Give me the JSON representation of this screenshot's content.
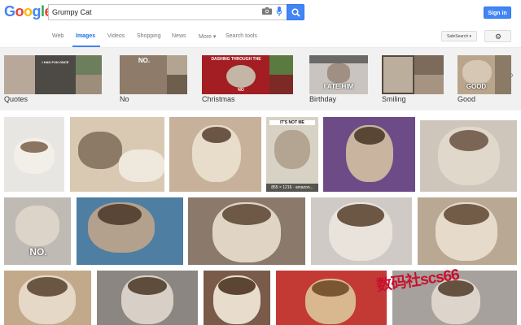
{
  "header": {
    "logo_letters": [
      {
        "ch": "G",
        "color": "#4285f4"
      },
      {
        "ch": "o",
        "color": "#ea4335"
      },
      {
        "ch": "o",
        "color": "#fbbc05"
      },
      {
        "ch": "g",
        "color": "#4285f4"
      },
      {
        "ch": "l",
        "color": "#34a853"
      },
      {
        "ch": "e",
        "color": "#ea4335"
      }
    ],
    "search_value": "Grumpy Cat",
    "signin_label": "Sign in"
  },
  "nav": {
    "tabs": [
      "Web",
      "Images",
      "Videos",
      "Shopping",
      "News",
      "More ▾",
      "Search tools"
    ],
    "active_tab": "Images",
    "safesearch_label": "SafeSearch ▾"
  },
  "related": [
    "Quotes",
    "No",
    "Christmas",
    "Birthday",
    "Smiling",
    "Good"
  ],
  "captions": {
    "rel_quotes_top": "I HAD FUN ONCE",
    "rel_no": "NO.",
    "rel_christmas_top": "DASHING THROUGH THE",
    "rel_christmas_bottom": "NO",
    "rel_birthday_bottom": "I ATE HIM",
    "rel_good": "GOOD",
    "grid_itsnotme": "IT'S NOT ME",
    "grid_dims": "855 × 1216 · amazon...",
    "grid_no": "NO."
  },
  "watermark": "数码社scs66"
}
